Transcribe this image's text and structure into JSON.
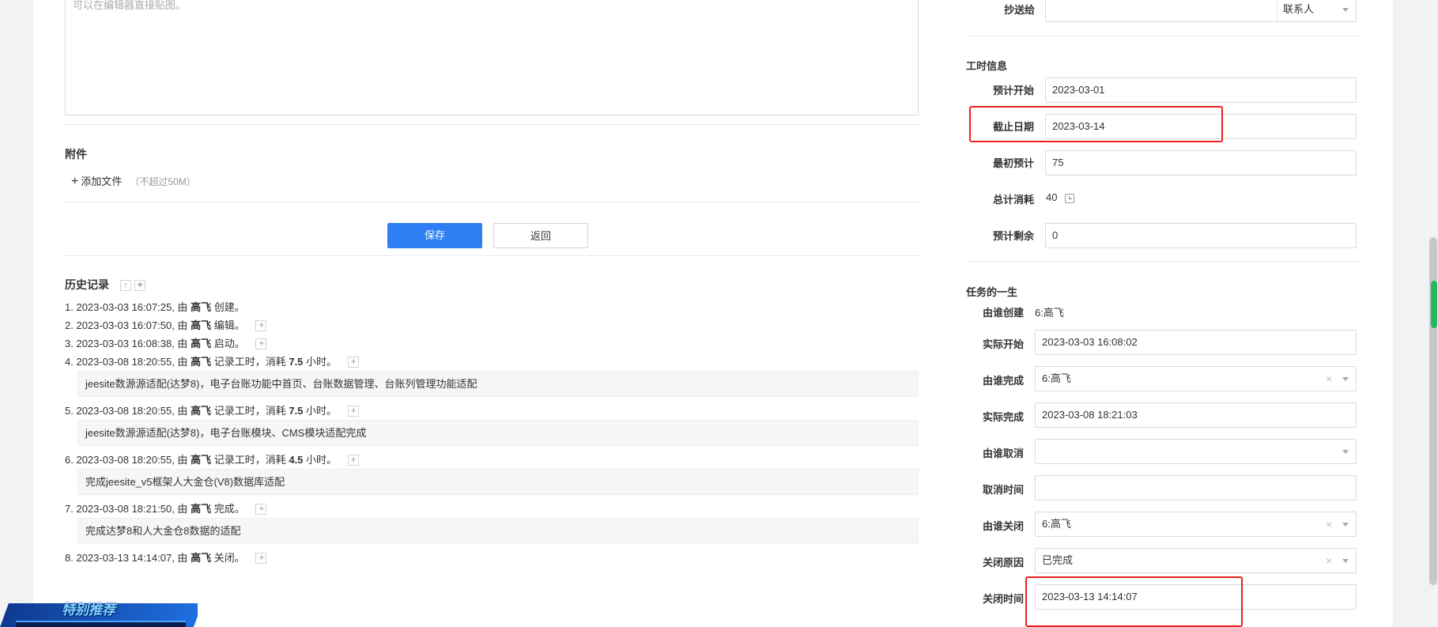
{
  "editor": {
    "placeholder": "可以在编辑器直接贴图。"
  },
  "attachments": {
    "title": "附件",
    "add_label": "添加文件",
    "hint": "（不超过50M）"
  },
  "actions": {
    "save": "保存",
    "back": "返回"
  },
  "history": {
    "title": "历史记录",
    "entries": [
      {
        "no": "1.",
        "time": "2023-03-03 16:07:25",
        "by": "由",
        "user": "高飞",
        "action": "创建。"
      },
      {
        "no": "2.",
        "time": "2023-03-03 16:07:50",
        "by": "由",
        "user": "高飞",
        "action": "编辑。"
      },
      {
        "no": "3.",
        "time": "2023-03-03 16:08:38",
        "by": "由",
        "user": "高飞",
        "action": "启动。"
      },
      {
        "no": "4.",
        "time": "2023-03-08 18:20:55",
        "by": "由",
        "user": "高飞",
        "action": "记录工时，消耗",
        "hours": "7.5",
        "unit": "小时。",
        "comment": "jeesite数源源适配(达梦8)，电子台账功能中首页、台账数据管理、台账列管理功能适配"
      },
      {
        "no": "5.",
        "time": "2023-03-08 18:20:55",
        "by": "由",
        "user": "高飞",
        "action": "记录工时，消耗",
        "hours": "7.5",
        "unit": "小时。",
        "comment": "jeesite数源源适配(达梦8)，电子台账模块、CMS模块适配完成"
      },
      {
        "no": "6.",
        "time": "2023-03-08 18:20:55",
        "by": "由",
        "user": "高飞",
        "action": "记录工时，消耗",
        "hours": "4.5",
        "unit": "小时。",
        "comment": "完成jeesite_v5框架人大金仓(V8)数据库适配"
      },
      {
        "no": "7.",
        "time": "2023-03-08 18:21:50",
        "by": "由",
        "user": "高飞",
        "action": "完成。",
        "comment": "完成达梦8和人大金仓8数据的适配"
      },
      {
        "no": "8.",
        "time": "2023-03-13 14:14:07",
        "by": "由",
        "user": "高飞",
        "action": "关闭。"
      }
    ]
  },
  "cc": {
    "label": "抄送给",
    "value": "",
    "contact": "联系人"
  },
  "work_hours": {
    "title": "工时信息",
    "est_start": {
      "label": "预计开始",
      "value": "2023-03-01"
    },
    "deadline": {
      "label": "截止日期",
      "value": "2023-03-14"
    },
    "initial_est": {
      "label": "最初预计",
      "value": "75"
    },
    "total_consumed": {
      "label": "总计消耗",
      "value": "40"
    },
    "est_remaining": {
      "label": "预计剩余",
      "value": "0"
    }
  },
  "lifecycle": {
    "title": "任务的一生",
    "created_by": {
      "label": "由谁创建",
      "value": "6:高飞"
    },
    "actual_start": {
      "label": "实际开始",
      "value": "2023-03-03 16:08:02"
    },
    "finished_by": {
      "label": "由谁完成",
      "value": "6:高飞"
    },
    "actual_finish": {
      "label": "实际完成",
      "value": "2023-03-08 18:21:03"
    },
    "canceled_by": {
      "label": "由谁取消",
      "value": ""
    },
    "cancel_time": {
      "label": "取消时间",
      "value": ""
    },
    "closed_by": {
      "label": "由谁关闭",
      "value": "6:高飞"
    },
    "close_reason": {
      "label": "关闭原因",
      "value": "已完成"
    },
    "close_time": {
      "label": "关闭时间",
      "value": "2023-03-13 14:14:07"
    }
  },
  "banner": {
    "text": "特别推荐"
  },
  "colors": {
    "primary": "#2e7ff3",
    "highlight": "#e8221f"
  }
}
